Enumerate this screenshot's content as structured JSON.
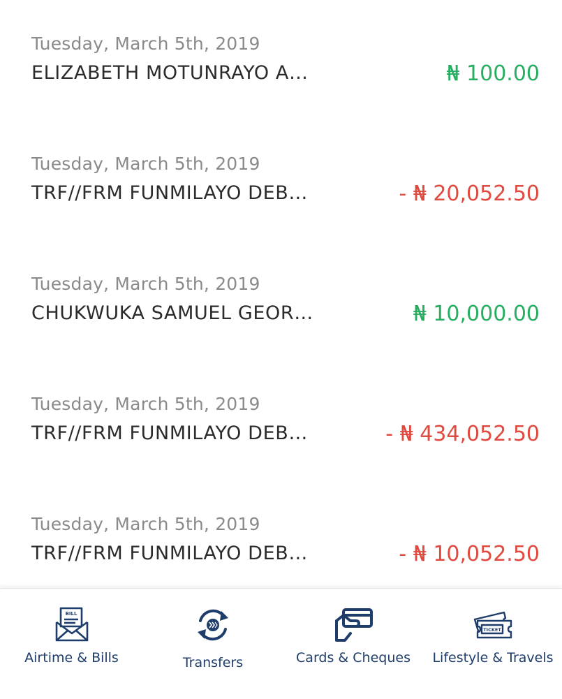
{
  "colors": {
    "credit": "#27ae60",
    "debit": "#e04a3f",
    "nav": "#1f3d6b"
  },
  "transactions": [
    {
      "date": "Tuesday, March 5th, 2019",
      "name": "ELIZABETH MOTUNRAYO A…",
      "amount": "₦ 100.00",
      "type": "credit"
    },
    {
      "date": "Tuesday, March 5th, 2019",
      "name": "TRF//FRM FUNMILAYO DEB…",
      "amount": "- ₦ 20,052.50",
      "type": "debit"
    },
    {
      "date": "Tuesday, March 5th, 2019",
      "name": "CHUKWUKA SAMUEL GEOR…",
      "amount": "₦ 10,000.00",
      "type": "credit"
    },
    {
      "date": "Tuesday, March 5th, 2019",
      "name": "TRF//FRM FUNMILAYO DEB…",
      "amount": "- ₦ 434,052.50",
      "type": "debit"
    },
    {
      "date": "Tuesday, March 5th, 2019",
      "name": "TRF//FRM FUNMILAYO DEB…",
      "amount": "- ₦ 10,052.50",
      "type": "debit"
    }
  ],
  "bottom_nav": [
    {
      "label": "Airtime & Bills",
      "icon": "bill-envelope-icon",
      "icon_text": "BILL"
    },
    {
      "label": "Transfers",
      "icon": "transfer-cycle-icon"
    },
    {
      "label": "Cards & Cheques",
      "icon": "card-hand-icon"
    },
    {
      "label": "Lifestyle & Travels",
      "icon": "ticket-icon",
      "icon_text": "TICKET"
    }
  ]
}
